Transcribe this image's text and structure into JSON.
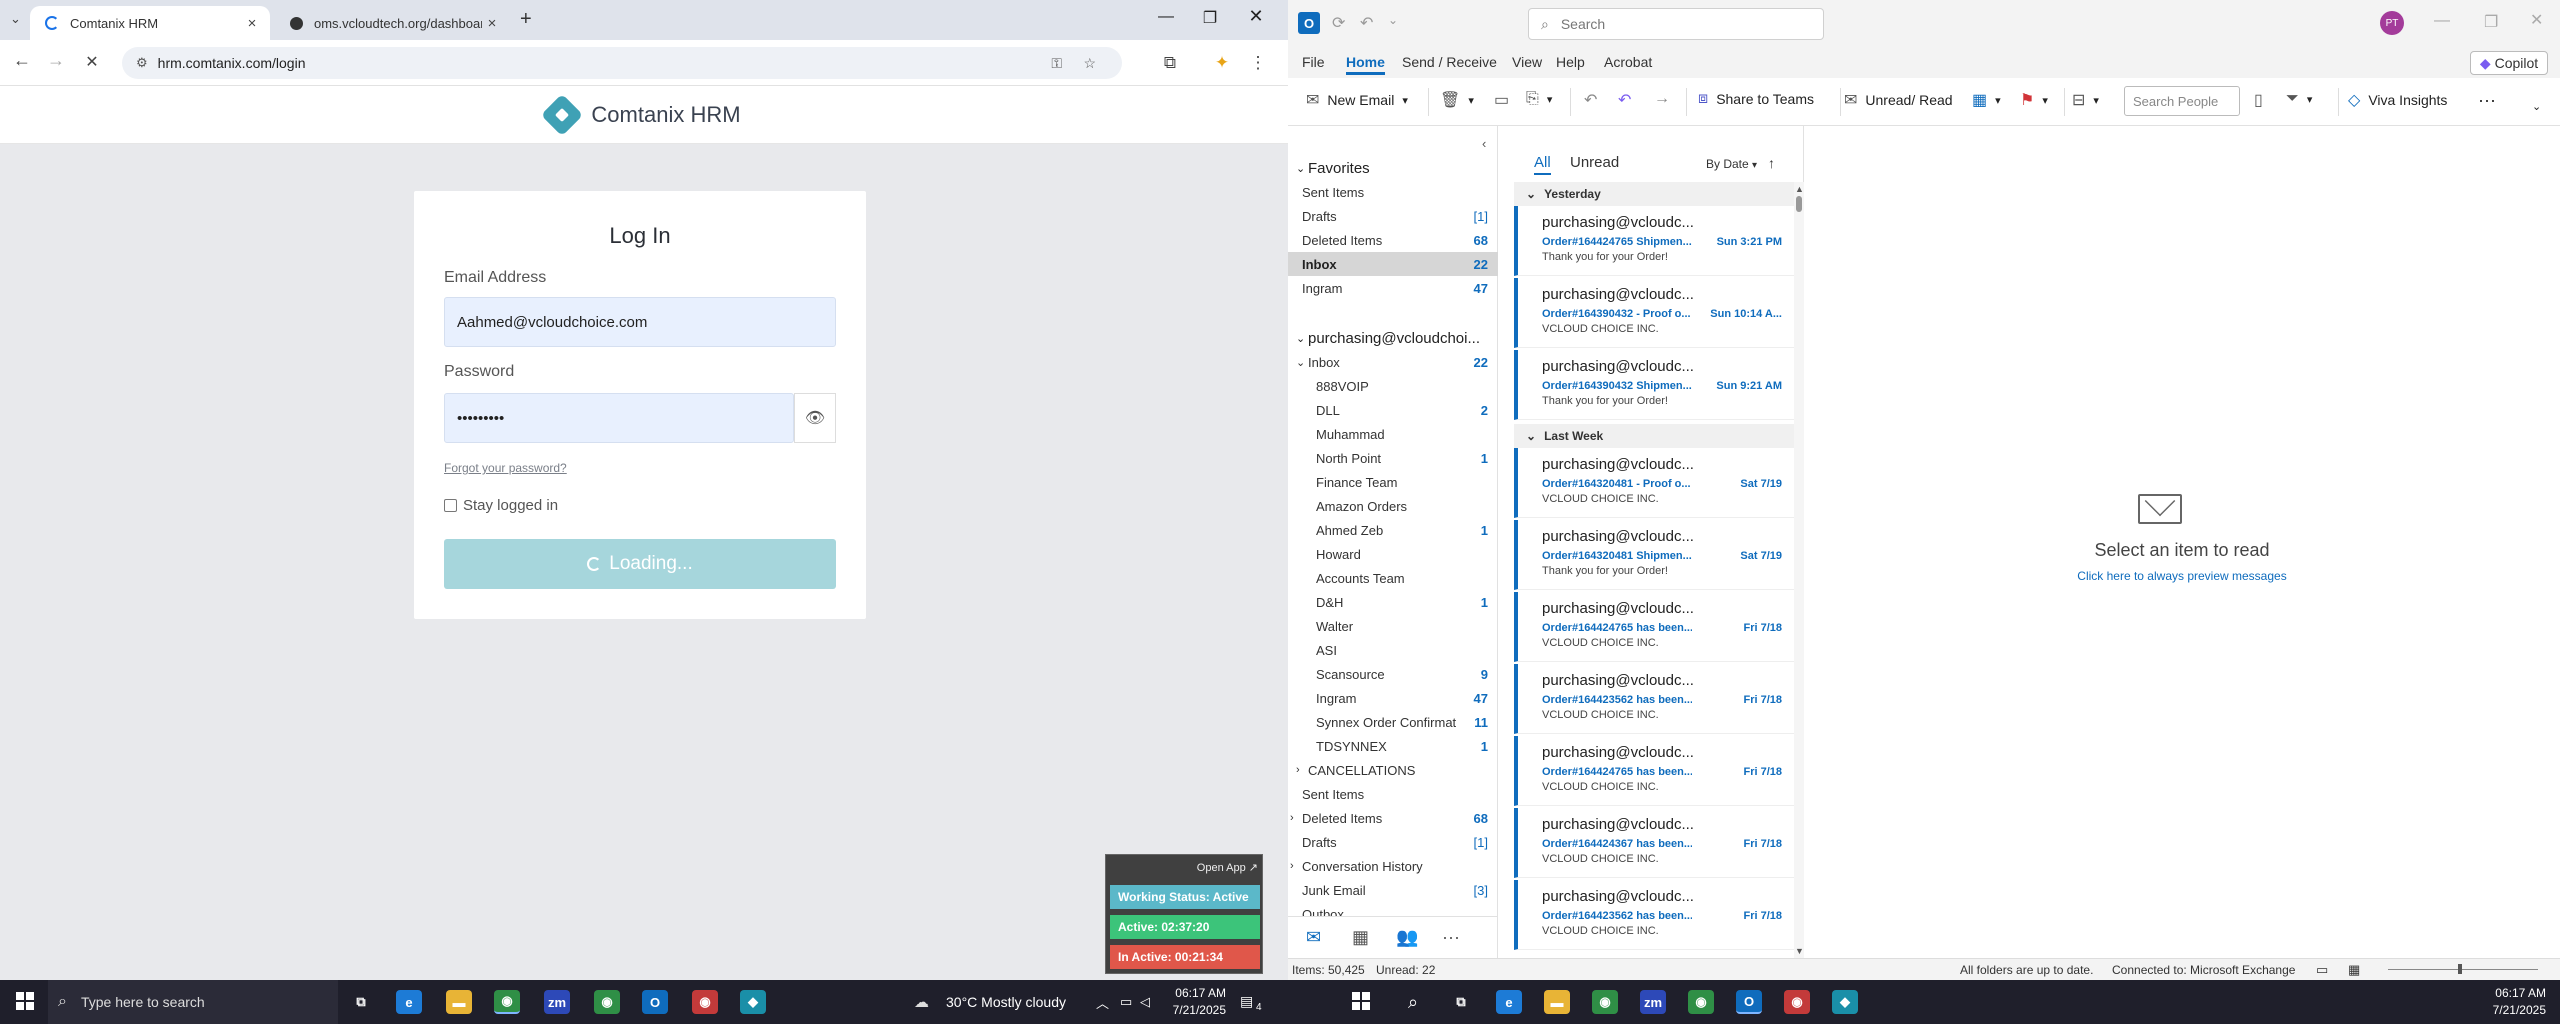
{
  "chrome": {
    "tabs": [
      {
        "title": "Comtanix HRM",
        "loading": true
      },
      {
        "title": "oms.vcloudtech.org/dashboard"
      }
    ],
    "url": "hrm.comtanix.com/login"
  },
  "hrm": {
    "brand": "Comtanix HRM",
    "login_title": "Log In",
    "email_label": "Email Address",
    "email_value": "Aahmed@vcloudchoice.com",
    "password_label": "Password",
    "password_value": "•••••••••",
    "forgot_link": "Forgot your password?",
    "stay_logged": "Stay logged in",
    "button_label": "Loading..."
  },
  "widget": {
    "open_app": "Open App ↗",
    "status": "Working Status: Active",
    "active": "Active: 02:37:20",
    "inactive": "In Active: 00:21:34",
    "colors": {
      "status": "#5bb8c9",
      "active": "#3cc47a",
      "inactive": "#e0574a"
    }
  },
  "outlook": {
    "search_placeholder": "Search",
    "avatar": "PT",
    "menu": [
      "File",
      "Home",
      "Send / Receive",
      "View",
      "Help",
      "Acrobat"
    ],
    "active_menu": "Home",
    "copilot": "Copilot",
    "ribbon": {
      "new_email": "New Email",
      "share_teams": "Share to Teams",
      "unread_read": "Unread/ Read",
      "search_people": "Search People",
      "viva": "Viva Insights"
    },
    "favorites_header": "Favorites",
    "favorites": [
      {
        "name": "Sent Items",
        "count": ""
      },
      {
        "name": "Drafts",
        "count": "[1]"
      },
      {
        "name": "Deleted Items",
        "count": "68"
      },
      {
        "name": "Inbox",
        "count": "22"
      },
      {
        "name": "Ingram",
        "count": "47"
      }
    ],
    "account": "purchasing@vcloudchoi...",
    "inbox": {
      "name": "Inbox",
      "count": "22"
    },
    "subfolders": [
      {
        "name": "888VOIP",
        "count": ""
      },
      {
        "name": "DLL",
        "count": "2"
      },
      {
        "name": "Muhammad",
        "count": ""
      },
      {
        "name": "North Point",
        "count": "1"
      },
      {
        "name": "Finance Team",
        "count": ""
      },
      {
        "name": "Amazon Orders",
        "count": ""
      },
      {
        "name": "Ahmed Zeb",
        "count": "1"
      },
      {
        "name": "Howard",
        "count": ""
      },
      {
        "name": "Accounts Team",
        "count": ""
      },
      {
        "name": "D&H",
        "count": "1"
      },
      {
        "name": "Walter",
        "count": ""
      },
      {
        "name": "ASI",
        "count": ""
      },
      {
        "name": "Scansource",
        "count": "9"
      },
      {
        "name": "Ingram",
        "count": "47"
      },
      {
        "name": "Synnex Order Confirmati...",
        "count": "11"
      },
      {
        "name": "TDSYNNEX",
        "count": "1"
      },
      {
        "name": "CANCELLATIONS",
        "count": ""
      }
    ],
    "other_folders": [
      {
        "name": "Sent Items",
        "count": "",
        "chev": ""
      },
      {
        "name": "Deleted Items",
        "count": "68",
        "chev": "›"
      },
      {
        "name": "Drafts",
        "count": "[1]",
        "chev": ""
      },
      {
        "name": "Conversation History",
        "count": "",
        "chev": "›"
      },
      {
        "name": "Junk Email",
        "count": "[3]",
        "chev": ""
      },
      {
        "name": "Outbox",
        "count": "",
        "chev": ""
      }
    ],
    "list_tabs": [
      "All",
      "Unread"
    ],
    "sort": "By Date",
    "groups": [
      "Yesterday",
      "Last Week"
    ],
    "messages": [
      {
        "from": "purchasing@vcloudc...",
        "subject": "Order#164424765 Shipmen...",
        "date": "Sun 3:21 PM",
        "preview": "Thank you for your Order!"
      },
      {
        "from": "purchasing@vcloudc...",
        "subject": "Order#164390432 - Proof o...",
        "date": "Sun 10:14 A...",
        "preview": "VCLOUD CHOICE INC."
      },
      {
        "from": "purchasing@vcloudc...",
        "subject": "Order#164390432 Shipmen...",
        "date": "Sun 9:21 AM",
        "preview": "Thank you for your Order!"
      },
      {
        "from": "purchasing@vcloudc...",
        "subject": "Order#164320481 - Proof o...",
        "date": "Sat 7/19",
        "preview": "VCLOUD CHOICE INC."
      },
      {
        "from": "purchasing@vcloudc...",
        "subject": "Order#164320481 Shipmen...",
        "date": "Sat 7/19",
        "preview": "Thank you for your Order!"
      },
      {
        "from": "purchasing@vcloudc...",
        "subject": "Order#164424765 has been...",
        "date": "Fri 7/18",
        "preview": "VCLOUD CHOICE INC."
      },
      {
        "from": "purchasing@vcloudc...",
        "subject": "Order#164423562 has been...",
        "date": "Fri 7/18",
        "preview": "VCLOUD CHOICE INC."
      },
      {
        "from": "purchasing@vcloudc...",
        "subject": "Order#164424765 has been...",
        "date": "Fri 7/18",
        "preview": "VCLOUD CHOICE INC."
      },
      {
        "from": "purchasing@vcloudc...",
        "subject": "Order#164424367 has been...",
        "date": "Fri 7/18",
        "preview": "VCLOUD CHOICE INC."
      },
      {
        "from": "purchasing@vcloudc...",
        "subject": "Order#164423562 has been...",
        "date": "Fri 7/18",
        "preview": "VCLOUD CHOICE INC."
      }
    ],
    "reading": {
      "title": "Select an item to read",
      "link": "Click here to always preview messages"
    },
    "status": {
      "items": "Items: 50,425",
      "unread": "Unread: 22",
      "sync": "All folders are up to date.",
      "connection": "Connected to: Microsoft Exchange"
    }
  },
  "taskbar": {
    "search_placeholder": "Type here to search",
    "weather": "30°C  Mostly cloudy",
    "time": "06:17 AM",
    "date": "7/21/2025",
    "notifications": "4"
  }
}
